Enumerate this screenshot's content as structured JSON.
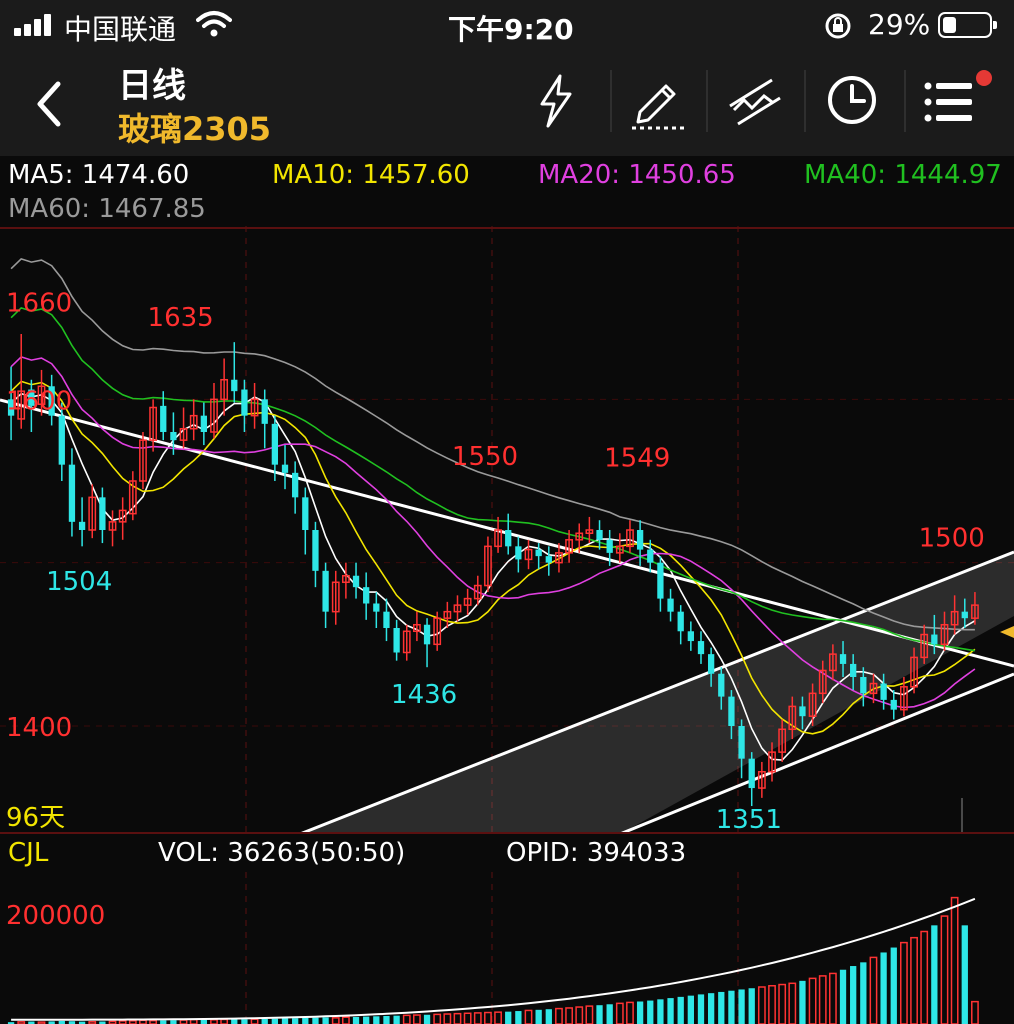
{
  "status_bar": {
    "carrier": "中国联通",
    "time": "下午9:20",
    "battery_percent": "29%",
    "battery_level": 0.29
  },
  "header": {
    "back_icon": "chevron-left-icon",
    "period": "日线",
    "symbol": "玻璃2305",
    "symbol_color": "#f0b92c",
    "tools": [
      "flash-icon",
      "draw-pen-icon",
      "trendline-icon",
      "clock-icon",
      "menu-icon"
    ],
    "menu_badge_color": "#e53935"
  },
  "ma_labels": {
    "ma5": "MA5: 1474.60",
    "ma10": "MA10: 1457.60",
    "ma20": "MA20: 1450.65",
    "ma40": "MA40: 1444.97",
    "ma60": "MA60: 1467.85",
    "colors": {
      "ma5": "#ffffff",
      "ma10": "#f2e500",
      "ma20": "#e040e0",
      "ma40": "#20c020",
      "ma60": "#9a9a9a"
    }
  },
  "price_chart": {
    "y_axis_labels": [
      "1660",
      "1600",
      "1400"
    ],
    "days_label": "96天",
    "annotations": {
      "high_left": "1635",
      "low_left": "1504",
      "high_mid1": "1550",
      "low_mid": "1436",
      "high_mid2": "1549",
      "low_right": "1351",
      "high_right": "1500"
    },
    "colors": {
      "up": "#ff3333",
      "down": "#2ee6e6",
      "label_red": "#ff3030",
      "label_cyan": "#2ee6e6"
    }
  },
  "volume_panel": {
    "indicator": "CJL",
    "vol": "VOL: 36263(50:50)",
    "opid": "OPID: 394033",
    "y_label": "200000"
  },
  "chart_data": {
    "type": "candlestick",
    "ylim": [
      1340,
      1700
    ],
    "candles": [
      [
        1600,
        1590,
        1620,
        1575
      ],
      [
        1588,
        1605,
        1640,
        1582
      ],
      [
        1606,
        1596,
        1612,
        1580
      ],
      [
        1597,
        1608,
        1618,
        1590
      ],
      [
        1608,
        1590,
        1615,
        1584
      ],
      [
        1590,
        1560,
        1598,
        1550
      ],
      [
        1560,
        1525,
        1570,
        1516
      ],
      [
        1525,
        1520,
        1540,
        1510
      ],
      [
        1520,
        1540,
        1548,
        1515
      ],
      [
        1540,
        1520,
        1546,
        1512
      ],
      [
        1520,
        1525,
        1532,
        1510
      ],
      [
        1525,
        1532,
        1540,
        1514
      ],
      [
        1530,
        1550,
        1556,
        1526
      ],
      [
        1550,
        1575,
        1580,
        1545
      ],
      [
        1575,
        1595,
        1600,
        1568
      ],
      [
        1596,
        1580,
        1605,
        1575
      ],
      [
        1580,
        1575,
        1592,
        1566
      ],
      [
        1575,
        1582,
        1595,
        1570
      ],
      [
        1582,
        1590,
        1600,
        1575
      ],
      [
        1590,
        1580,
        1598,
        1572
      ],
      [
        1580,
        1600,
        1610,
        1576
      ],
      [
        1600,
        1612,
        1625,
        1590
      ],
      [
        1612,
        1605,
        1635,
        1598
      ],
      [
        1606,
        1590,
        1612,
        1580
      ],
      [
        1590,
        1600,
        1610,
        1582
      ],
      [
        1600,
        1585,
        1606,
        1570
      ],
      [
        1585,
        1560,
        1590,
        1550
      ],
      [
        1560,
        1555,
        1572,
        1545
      ],
      [
        1555,
        1540,
        1562,
        1530
      ],
      [
        1540,
        1520,
        1546,
        1505
      ],
      [
        1520,
        1495,
        1525,
        1485
      ],
      [
        1495,
        1470,
        1500,
        1460
      ],
      [
        1470,
        1488,
        1495,
        1462
      ],
      [
        1488,
        1492,
        1500,
        1478
      ],
      [
        1492,
        1485,
        1500,
        1478
      ],
      [
        1485,
        1475,
        1494,
        1465
      ],
      [
        1475,
        1470,
        1482,
        1460
      ],
      [
        1470,
        1460,
        1478,
        1452
      ],
      [
        1460,
        1445,
        1465,
        1440
      ],
      [
        1445,
        1458,
        1462,
        1440
      ],
      [
        1458,
        1462,
        1470,
        1452
      ],
      [
        1462,
        1450,
        1466,
        1436
      ],
      [
        1450,
        1466,
        1470,
        1446
      ],
      [
        1466,
        1470,
        1476,
        1460
      ],
      [
        1470,
        1474,
        1480,
        1464
      ],
      [
        1474,
        1478,
        1484,
        1468
      ],
      [
        1478,
        1486,
        1492,
        1474
      ],
      [
        1486,
        1510,
        1516,
        1482
      ],
      [
        1510,
        1520,
        1528,
        1506
      ],
      [
        1520,
        1510,
        1530,
        1505
      ],
      [
        1510,
        1502,
        1516,
        1494
      ],
      [
        1502,
        1508,
        1514,
        1496
      ],
      [
        1508,
        1504,
        1512,
        1496
      ],
      [
        1504,
        1500,
        1510,
        1492
      ],
      [
        1500,
        1506,
        1512,
        1494
      ],
      [
        1506,
        1514,
        1520,
        1500
      ],
      [
        1514,
        1518,
        1524,
        1506
      ],
      [
        1518,
        1520,
        1528,
        1512
      ],
      [
        1520,
        1514,
        1526,
        1508
      ],
      [
        1514,
        1506,
        1520,
        1498
      ],
      [
        1506,
        1510,
        1518,
        1500
      ],
      [
        1510,
        1520,
        1526,
        1506
      ],
      [
        1520,
        1508,
        1526,
        1498
      ],
      [
        1508,
        1500,
        1514,
        1494
      ],
      [
        1500,
        1478,
        1504,
        1470
      ],
      [
        1478,
        1470,
        1484,
        1464
      ],
      [
        1470,
        1458,
        1474,
        1450
      ],
      [
        1458,
        1452,
        1464,
        1446
      ],
      [
        1452,
        1444,
        1458,
        1438
      ],
      [
        1444,
        1432,
        1448,
        1424
      ],
      [
        1432,
        1418,
        1436,
        1410
      ],
      [
        1418,
        1400,
        1422,
        1392
      ],
      [
        1400,
        1380,
        1404,
        1368
      ],
      [
        1380,
        1362,
        1384,
        1351
      ],
      [
        1362,
        1372,
        1378,
        1356
      ],
      [
        1372,
        1384,
        1390,
        1366
      ],
      [
        1384,
        1398,
        1404,
        1378
      ],
      [
        1398,
        1412,
        1418,
        1392
      ],
      [
        1412,
        1406,
        1418,
        1398
      ],
      [
        1406,
        1420,
        1426,
        1400
      ],
      [
        1420,
        1434,
        1440,
        1414
      ],
      [
        1434,
        1444,
        1450,
        1428
      ],
      [
        1444,
        1438,
        1452,
        1430
      ],
      [
        1438,
        1430,
        1444,
        1422
      ],
      [
        1430,
        1420,
        1436,
        1412
      ],
      [
        1420,
        1426,
        1432,
        1414
      ],
      [
        1426,
        1416,
        1432,
        1410
      ],
      [
        1416,
        1410,
        1422,
        1404
      ],
      [
        1410,
        1424,
        1430,
        1406
      ],
      [
        1424,
        1442,
        1448,
        1420
      ],
      [
        1442,
        1456,
        1462,
        1438
      ],
      [
        1456,
        1450,
        1468,
        1444
      ],
      [
        1450,
        1462,
        1470,
        1446
      ],
      [
        1462,
        1470,
        1480,
        1456
      ],
      [
        1470,
        1466,
        1478,
        1460
      ],
      [
        1466,
        1474,
        1482,
        1462
      ]
    ],
    "volumes": [
      3000,
      3500,
      4000,
      3000,
      4200,
      5000,
      4500,
      3800,
      3600,
      4000,
      4200,
      5000,
      5200,
      6000,
      5500,
      5800,
      6200,
      6400,
      7000,
      7200,
      6800,
      7400,
      8000,
      7600,
      7800,
      8200,
      8600,
      9000,
      9400,
      9800,
      10200,
      10600,
      10000,
      11000,
      11400,
      12000,
      12500,
      13000,
      13500,
      14000,
      14500,
      15000,
      15600,
      16200,
      16800,
      17400,
      18000,
      18600,
      19200,
      20000,
      21000,
      22000,
      23000,
      24000,
      25000,
      26000,
      27500,
      29000,
      30500,
      32000,
      33500,
      35000,
      36500,
      38000,
      40000,
      42000,
      44000,
      46000,
      48000,
      50000,
      52000,
      54000,
      56000,
      58000,
      60000,
      62000,
      64000,
      66000,
      70000,
      74000,
      78000,
      82000,
      88000,
      94000,
      100000,
      108000,
      116000,
      124000,
      132000,
      140000,
      150000,
      160000,
      175000,
      205000,
      160000,
      36263
    ],
    "vol_ylim": [
      0,
      240000
    ]
  }
}
